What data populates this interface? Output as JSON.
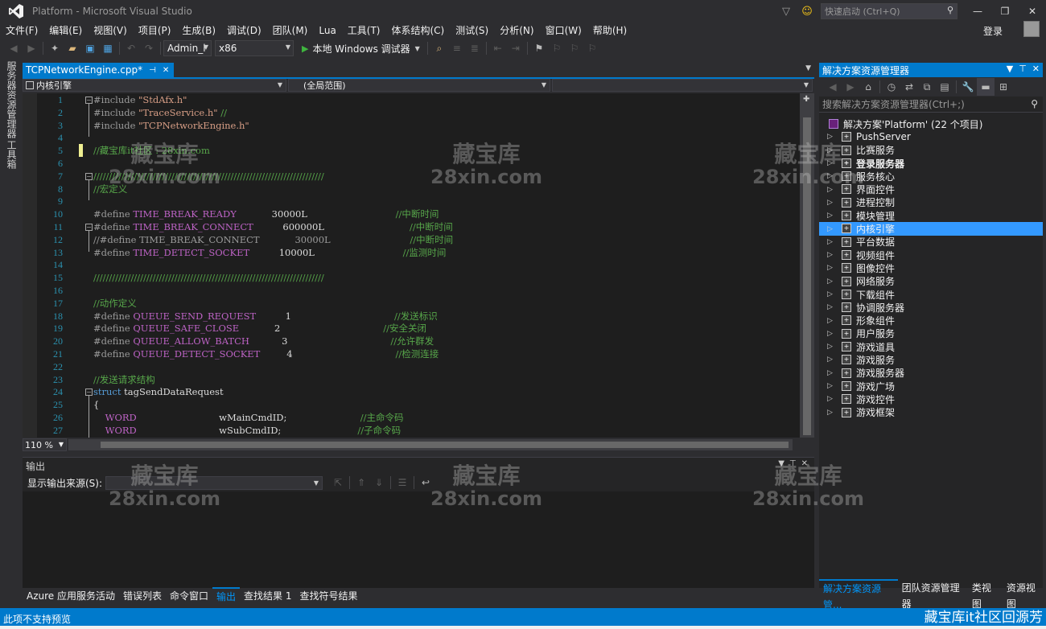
{
  "titlebar": {
    "title": "Platform - Microsoft Visual Studio",
    "quick_launch_placeholder": "快速启动 (Ctrl+Q)",
    "login": "登录"
  },
  "menu": [
    "文件(F)",
    "编辑(E)",
    "视图(V)",
    "项目(P)",
    "生成(B)",
    "调试(D)",
    "团队(M)",
    "Lua",
    "工具(T)",
    "体系结构(C)",
    "测试(S)",
    "分析(N)",
    "窗口(W)",
    "帮助(H)"
  ],
  "toolbar": {
    "config": "Admin_l",
    "platform": "x86",
    "debug_target": "本地 Windows 调试器"
  },
  "left_strip": {
    "server_explorer": "服务器资源管理器",
    "toolbox": "工具箱"
  },
  "editor": {
    "tab_title": "TCPNetworkEngine.cpp*",
    "nav_project": "内核引擎",
    "nav_scope": "(全局范围)",
    "zoom": "110 %",
    "lines": [
      {
        "n": "1",
        "tokens": [
          [
            "pre",
            "#include "
          ],
          [
            "str",
            "\"StdAfx.h\""
          ]
        ],
        "fold": "minus"
      },
      {
        "n": "2",
        "tokens": [
          [
            "pre",
            "#include "
          ],
          [
            "str",
            "\"TraceService.h\""
          ],
          [
            "com",
            " //"
          ]
        ]
      },
      {
        "n": "3",
        "tokens": [
          [
            "pre",
            "#include "
          ],
          [
            "str",
            "\"TCPNetworkEngine.h\""
          ]
        ]
      },
      {
        "n": "4",
        "tokens": []
      },
      {
        "n": "5",
        "tokens": [
          [
            "com",
            "//藏宝库it社区 : 28xin.com"
          ]
        ],
        "changed": true
      },
      {
        "n": "6",
        "tokens": []
      },
      {
        "n": "7",
        "tokens": [
          [
            "com",
            "//////////////////////////////////////////////////////////////////////////"
          ]
        ],
        "fold": "minus"
      },
      {
        "n": "8",
        "tokens": [
          [
            "com",
            "//宏定义"
          ]
        ]
      },
      {
        "n": "9",
        "tokens": []
      },
      {
        "n": "10",
        "tokens": [
          [
            "pre",
            "#define "
          ],
          [
            "mac",
            "TIME_BREAK_READY"
          ],
          [
            "num",
            "            30000L"
          ],
          [
            "com",
            "                              //中断时间"
          ]
        ]
      },
      {
        "n": "11",
        "tokens": [
          [
            "pre",
            "#define "
          ],
          [
            "mac",
            "TIME_BREAK_CONNECT"
          ],
          [
            "num",
            "          600000L"
          ],
          [
            "com",
            "                             //中断时间"
          ]
        ],
        "fold": "minus"
      },
      {
        "n": "12",
        "tokens": [
          [
            "pre",
            "//#define TIME_BREAK_CONNECT"
          ],
          [
            "pre",
            "            30000L"
          ],
          [
            "com",
            "                           //中断时间"
          ]
        ]
      },
      {
        "n": "13",
        "tokens": [
          [
            "pre",
            "#define "
          ],
          [
            "mac",
            "TIME_DETECT_SOCKET"
          ],
          [
            "num",
            "          10000L"
          ],
          [
            "com",
            "                              //监测时间"
          ]
        ]
      },
      {
        "n": "14",
        "tokens": []
      },
      {
        "n": "15",
        "tokens": [
          [
            "com",
            "//////////////////////////////////////////////////////////////////////////"
          ]
        ]
      },
      {
        "n": "16",
        "tokens": []
      },
      {
        "n": "17",
        "tokens": [
          [
            "com",
            "//动作定义"
          ]
        ]
      },
      {
        "n": "18",
        "tokens": [
          [
            "pre",
            "#define "
          ],
          [
            "mac",
            "QUEUE_SEND_REQUEST"
          ],
          [
            "num",
            "          1"
          ],
          [
            "com",
            "                                   //发送标识"
          ]
        ]
      },
      {
        "n": "19",
        "tokens": [
          [
            "pre",
            "#define "
          ],
          [
            "mac",
            "QUEUE_SAFE_CLOSE"
          ],
          [
            "num",
            "            2"
          ],
          [
            "com",
            "                                   //安全关闭"
          ]
        ]
      },
      {
        "n": "20",
        "tokens": [
          [
            "pre",
            "#define "
          ],
          [
            "mac",
            "QUEUE_ALLOW_BATCH"
          ],
          [
            "num",
            "           3"
          ],
          [
            "com",
            "                                   //允许群发"
          ]
        ]
      },
      {
        "n": "21",
        "tokens": [
          [
            "pre",
            "#define "
          ],
          [
            "mac",
            "QUEUE_DETECT_SOCKET"
          ],
          [
            "num",
            "         4"
          ],
          [
            "com",
            "                                   //检测连接"
          ]
        ]
      },
      {
        "n": "22",
        "tokens": []
      },
      {
        "n": "23",
        "tokens": [
          [
            "com",
            "//发送请求结构"
          ]
        ]
      },
      {
        "n": "24",
        "tokens": [
          [
            "kw",
            "struct "
          ],
          [
            "id",
            "tagSendDataRequest"
          ]
        ],
        "fold": "minus"
      },
      {
        "n": "25",
        "tokens": [
          [
            "id",
            "{"
          ]
        ]
      },
      {
        "n": "26",
        "tokens": [
          [
            "mac",
            "    WORD"
          ],
          [
            "id",
            "                            wMainCmdID;"
          ],
          [
            "com",
            "                         //主命令码"
          ]
        ]
      },
      {
        "n": "27",
        "tokens": [
          [
            "mac",
            "    WORD"
          ],
          [
            "id",
            "                            wSubCmdID;"
          ],
          [
            "com",
            "                          //子命令码"
          ]
        ]
      }
    ]
  },
  "output": {
    "title": "输出",
    "source_label": "显示输出来源(S):"
  },
  "bottom_tabs": [
    "Azure 应用服务活动",
    "错误列表",
    "命令窗口",
    "输出",
    "查找结果 1",
    "查找符号结果"
  ],
  "bottom_active": "输出",
  "solution": {
    "title": "解决方案资源管理器",
    "search_placeholder": "搜索解决方案资源管理器(Ctrl+;)",
    "root": "解决方案'Platform' (22 个项目)",
    "projects": [
      "PushServer",
      "比赛服务",
      "登录服务器",
      "服务核心",
      "界面控件",
      "进程控制",
      "模块管理",
      "内核引擎",
      "平台数据",
      "视频组件",
      "图像控件",
      "网络服务",
      "下载组件",
      "协调服务器",
      "形象组件",
      "用户服务",
      "游戏道具",
      "游戏服务",
      "游戏服务器",
      "游戏广场",
      "游戏控件",
      "游戏框架"
    ],
    "selected": "内核引擎",
    "bold": "登录服务器"
  },
  "right_tabs": [
    "解决方案资源管...",
    "团队资源管理器",
    "类视图",
    "资源视图"
  ],
  "right_active": "解决方案资源管...",
  "status": {
    "text": "此项不支持预览",
    "brand": "藏宝库it社区回源芳"
  },
  "watermark": {
    "line1": "藏宝库",
    "line2": "28xin.com"
  },
  "colors": {
    "accent": "#007acc",
    "background": "#2d2d30",
    "editor_bg": "#1e1e1e",
    "selection": "#3399ff"
  }
}
